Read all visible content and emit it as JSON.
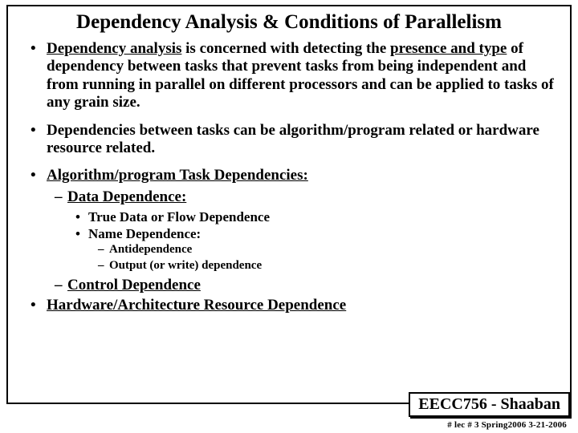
{
  "title": "Dependency Analysis & Conditions of Parallelism",
  "b1": {
    "p1a": "Dependency analysis",
    "p1b": " is concerned with detecting the ",
    "p1c": "presence and type",
    "p1d": " of dependency between tasks that prevent tasks from being independent and from running in parallel on different processors and can be applied to tasks of any grain size.",
    "p2": "Dependencies between tasks can be algorithm/program related or hardware resource related.",
    "p3": "Algorithm/program Task Dependencies:",
    "p4": "Hardware/Architecture Resource Dependence"
  },
  "b2": {
    "data_dep": "Data Dependence:",
    "control_dep": "Control Dependence"
  },
  "b3": {
    "true_data": "True Data or Flow Dependence",
    "name_dep": "Name Dependence:"
  },
  "b4": {
    "anti": "Antidependence",
    "output": "Output (or write) dependence"
  },
  "course": "EECC756 - Shaaban",
  "footer": "#   lec # 3    Spring2006  3-21-2006"
}
